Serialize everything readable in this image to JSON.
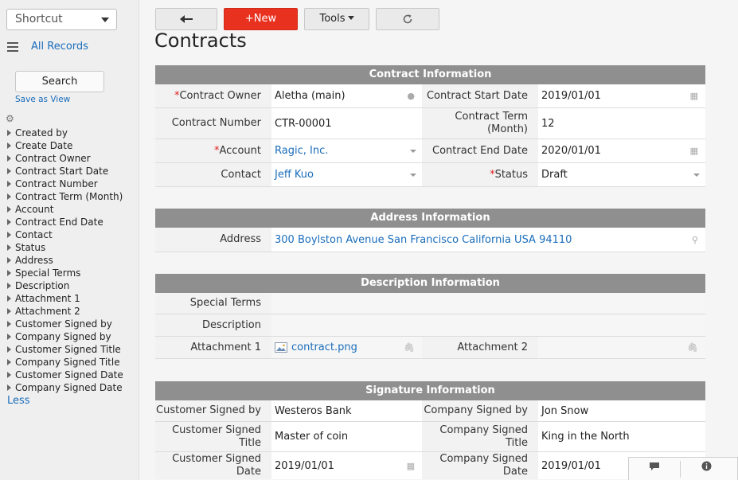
{
  "sidebar": {
    "shortcut_label": "Shortcut",
    "all_records": "All Records",
    "search_label": "Search",
    "save_as_view": "Save as View",
    "fields": [
      "Created by",
      "Create Date",
      "Contract Owner",
      "Contract Start Date",
      "Contract Number",
      "Contract Term (Month)",
      "Account",
      "Contract End Date",
      "Contact",
      "Status",
      "Address",
      "Special Terms",
      "Description",
      "Attachment 1",
      "Attachment 2",
      "Customer Signed by",
      "Company Signed by",
      "Customer Signed Title",
      "Company Signed Title",
      "Customer Signed Date",
      "Company Signed Date"
    ],
    "less": "Less"
  },
  "toolbar": {
    "new_label": "+New",
    "tools_label": "Tools"
  },
  "page_title": "Contracts",
  "sections": {
    "contract": {
      "title": "Contract Information",
      "contract_owner_label": "Contract Owner",
      "contract_owner": "Aletha (main)",
      "start_date_label": "Contract Start Date",
      "start_date": "2019/01/01",
      "contract_number_label": "Contract Number",
      "contract_number": "CTR-00001",
      "term_label": "Contract Term (Month)",
      "term": "12",
      "account_label": "Account",
      "account": "Ragic, Inc.",
      "end_date_label": "Contract End Date",
      "end_date": "2020/01/01",
      "contact_label": "Contact",
      "contact": "Jeff Kuo",
      "status_label": "Status",
      "status": "Draft"
    },
    "address": {
      "title": "Address Information",
      "address_label": "Address",
      "address": "300 Boylston Avenue San Francisco California USA 94110"
    },
    "description": {
      "title": "Description Information",
      "special_terms_label": "Special Terms",
      "description_label": "Description",
      "attachment1_label": "Attachment 1",
      "attachment1": "contract.png",
      "attachment2_label": "Attachment 2"
    },
    "signature": {
      "title": "Signature Information",
      "customer_signed_by_label": "Customer Signed by",
      "customer_signed_by": "Westeros Bank",
      "company_signed_by_label": "Company Signed by",
      "company_signed_by": "Jon Snow",
      "customer_title_label": "Customer Signed Title",
      "customer_title": "Master of coin",
      "company_title_label": "Company Signed Title",
      "company_title": "King in the North",
      "customer_date_label": "Customer Signed Date",
      "customer_date": "2019/01/01",
      "company_date_label": "Company Signed Date",
      "company_date": "2019/01/01"
    }
  }
}
